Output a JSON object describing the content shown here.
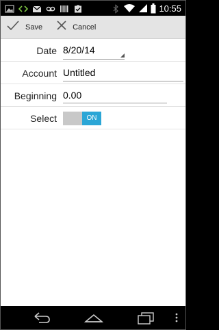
{
  "status_bar": {
    "icons": [
      "image-icon",
      "code-icon",
      "gmail-icon",
      "voicemail-icon",
      "barcode-icon",
      "clipboard-check-icon",
      "bluetooth-icon",
      "wifi-icon",
      "signal-icon",
      "battery-icon"
    ],
    "time": "10:55"
  },
  "action_bar": {
    "save_label": "Save",
    "cancel_label": "Cancel"
  },
  "form": {
    "date": {
      "label": "Date",
      "value": "8/20/14"
    },
    "account": {
      "label": "Account",
      "value": "Untitled"
    },
    "beginning": {
      "label": "Beginning",
      "value": "0.00"
    },
    "select": {
      "label": "Select",
      "value": "ON"
    }
  },
  "colors": {
    "toggle_accent": "#2ba6d6",
    "action_bar_bg": "#e4e4e4"
  }
}
